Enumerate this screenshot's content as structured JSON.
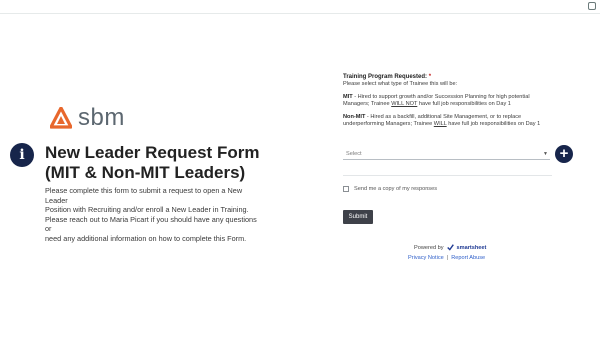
{
  "brand": {
    "logo_text": "sbm",
    "accent": "#e8672c"
  },
  "form": {
    "title_line1": "New Leader Request Form",
    "title_line2": "(MIT & Non-MIT Leaders)",
    "intro_line1": "Please complete this form to submit a request to open a New Leader",
    "intro_line2": "Position with Recruiting and/or enroll a New Leader in Training.",
    "intro_line3": "Please reach out to Maria Picart if you should have any questions or",
    "intro_line4": "need any additional information on how to complete this Form."
  },
  "question": {
    "label": "Training Program Requested:",
    "required_mark": "*",
    "help": "Please select what type of Trainee this will be:",
    "mit_head": "MIT",
    "mit_text1": " - Hired to support growth and/or Succession Planning for high potential",
    "mit_text2_pre": "Managers; Trainee ",
    "mit_emph": "WILL NOT",
    "mit_text2_post": " have full job responsibilities on Day 1",
    "nonmit_head": "Non-MIT",
    "nonmit_text1": " - Hired as a backfill, additional Site Management, or to replace",
    "nonmit_text2_pre": "underperforming Managers; Trainee ",
    "nonmit_emph": "WILL",
    "nonmit_text2_post": " have full job responsibilities on Day 1"
  },
  "select": {
    "placeholder": "Select"
  },
  "copy_checkbox": {
    "label": "Send me a copy of my responses",
    "checked": false
  },
  "submit_label": "Submit",
  "footer": {
    "powered_by": "Powered by",
    "provider": "smartsheet",
    "privacy_link": "Privacy Notice",
    "separator": "|",
    "report_link": "Report Abuse"
  },
  "icons": {
    "info": "info-icon",
    "add": "plus-icon"
  },
  "colors": {
    "dark_button": "#17254b",
    "submit": "#3e4149",
    "link": "#2f5fc9",
    "required": "#c02020"
  }
}
